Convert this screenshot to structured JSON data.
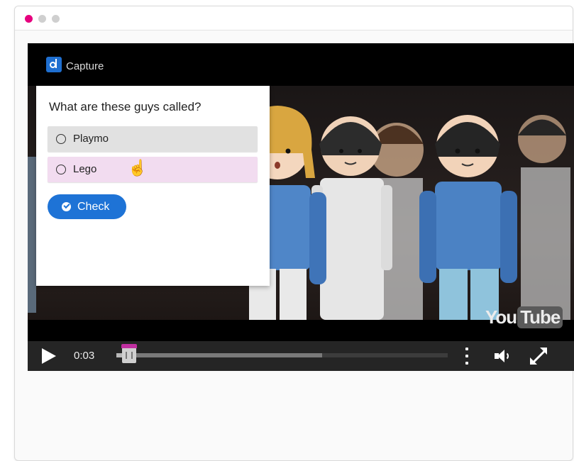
{
  "window": {
    "dots": [
      {
        "color": "#e6007e"
      },
      {
        "color": "#cfcfcf"
      },
      {
        "color": "#cfcfcf"
      }
    ]
  },
  "player": {
    "brand_text": "Capture",
    "brand_icon": "capture-logo-icon",
    "quiz": {
      "question": "What are these guys called?",
      "options": [
        {
          "label": "Playmo",
          "highlight": "#e1e1e1"
        },
        {
          "label": "Lego",
          "highlight": "#f2dcf0"
        }
      ],
      "check_label": "Check",
      "check_color": "#1e73d6"
    },
    "watermark": {
      "you": "You",
      "tube": "Tube"
    },
    "controls": {
      "time": "0:03",
      "progress_fraction": 0.03,
      "buffered_fraction": 0.62,
      "icons": [
        "play-icon",
        "more-vertical-icon",
        "volume-icon",
        "fullscreen-icon"
      ]
    },
    "accent": "#c02fa0"
  }
}
